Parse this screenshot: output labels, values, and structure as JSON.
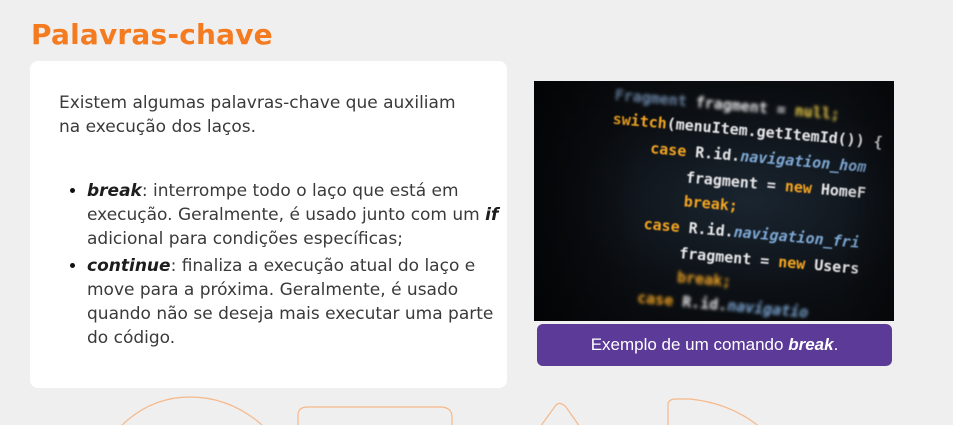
{
  "title": "Palavras-chave",
  "intro": "Existem algumas palavras-chave que auxiliam na execução dos laços.",
  "items": [
    {
      "keyword": "break",
      "text_a": ": interrompe todo o laço que está em execução. Geralmente, é usado junto com um ",
      "inline_keyword": "if",
      "text_b": " adicional para condições específicas;"
    },
    {
      "keyword": "continue",
      "text_a": ": finaliza a execução atual do laço e move para a próxima. Geralmente, é usado quando não se deseja mais executar uma parte do código."
    }
  ],
  "image": {
    "code_lines": [
      "Fragment fragment = null;",
      "switch(menuItem.getItemId()) {",
      "case R.id.navigation_hom",
      "fragment = new HomeF",
      "break;",
      "case R.id.navigation_fri",
      "fragment = new Users",
      "break;",
      "case R.id.navigatio"
    ],
    "caption_prefix": "Exemplo de um comando ",
    "caption_keyword": "break",
    "caption_suffix": "."
  },
  "colors": {
    "title": "#f47b20",
    "caption_bg": "#5b3a98",
    "code_white": "#e8e8ea",
    "code_orange": "#f5a623",
    "code_yellow": "#f7d54a",
    "code_blue": "#7fa9d6"
  }
}
